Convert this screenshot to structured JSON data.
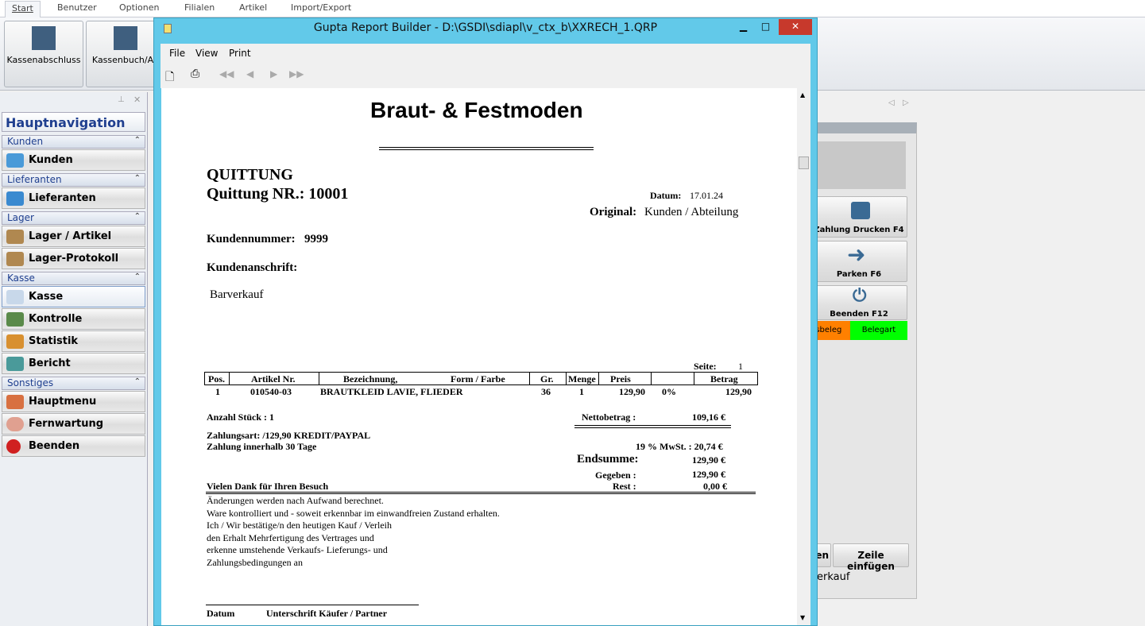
{
  "tabs": [
    "Start",
    "Benutzer",
    "Optionen",
    "Filialen",
    "Artikel",
    "Import/Export"
  ],
  "ribbon": {
    "kassenabschluss": "Kassenabschluss",
    "kassenbuch": "Kassenbuch/Au"
  },
  "sidebar": {
    "title": "Hauptnavigation",
    "sections": {
      "kunden": "Kunden",
      "lieferanten": "Lieferanten",
      "lager": "Lager",
      "kasse": "Kasse",
      "sonstiges": "Sonstiges"
    },
    "items": {
      "kunden": "Kunden",
      "lieferanten": "Lieferanten",
      "lager_artikel": "Lager / Artikel",
      "lager_protokoll": "Lager-Protokoll",
      "kasse": "Kasse",
      "kontrolle": "Kontrolle",
      "statistik": "Statistik",
      "bericht": "Bericht",
      "hauptmenu": "Hauptmenu",
      "fernwartung": "Fernwartung",
      "beenden": "Beenden"
    }
  },
  "right": {
    "zahlung_drucken": "Zahlung Drucken F4",
    "parken": "Parken F6",
    "beenden": "Beenden  F12",
    "beleg": "gsbeleg",
    "belegart": "Belegart",
    "btn_partial": "en",
    "zeile_einfuegen": "Zeile einfügen",
    "verkauf": "erkauf",
    "colors": {
      "orange": "#ff8000",
      "green": "#00ff00"
    }
  },
  "dialog": {
    "title": "Gupta Report Builder - D:\\GSDI\\sdiapl\\v_ctx_b\\XXRECH_1.QRP",
    "menu": [
      "File",
      "View",
      "Print"
    ]
  },
  "report": {
    "company": "Braut- & Festmoden",
    "doc_type": "QUITTUNG",
    "doc_nr_label": "Quittung  NR.:",
    "doc_nr": "10001",
    "datum_label": "Datum:",
    "datum": "17.01.24",
    "original_label": "Original:",
    "original": "Kunden / Abteilung",
    "kundennummer_label": "Kundennummer:",
    "kundennummer": "9999",
    "anschrift_label": "Kundenanschrift:",
    "anschrift": "Barverkauf",
    "seite_label": "Seite:",
    "seite": "1",
    "columns": [
      "Pos.",
      "Artikel Nr.",
      "Bezeichnung,",
      "Form / Farbe",
      "Gr.",
      "Menge",
      "Preis",
      "",
      "Betrag"
    ],
    "rows": [
      {
        "pos": "1",
        "artikel": "010540-03",
        "bez": "BRAUTKLEID LAVIE, FLIEDER",
        "gr": "36",
        "menge": "1",
        "preis": "129,90",
        "rabatt": "0%",
        "betrag": "129,90"
      }
    ],
    "anzahl": "Anzahl Stück : 1",
    "netto_label": "Nettobetrag :",
    "netto": "109,16 €",
    "zahlungsart": "Zahlungsart:  /129,90 KREDIT/PAYPAL",
    "zahlung_frist": "Zahlung innerhalb 30 Tage",
    "mwst": "19 % MwSt. : 20,74 €",
    "endsumme_label": "Endsumme:",
    "endsumme": "129,90 €",
    "gegeben_label": "Gegeben :",
    "gegeben": "129,90 €",
    "rest_label": "Rest :",
    "rest": "0,00 €",
    "dank": "Vielen Dank für Ihren Besuch",
    "footer_lines": [
      "Änderungen werden nach Aufwand berechnet.",
      "Ware kontrolliert und - soweit erkennbar im einwandfreien Zustand erhalten.",
      "Ich / Wir bestätige/n den heutigen Kauf / Verleih",
      "den Erhalt Mehrfertigung des Vertrages und",
      "erkenne umstehende Verkaufs- Lieferungs- und",
      "Zahlungsbedingungen an"
    ],
    "sig_datum": "Datum",
    "sig_unterschrift": "Unterschrift  Käufer / Partner"
  }
}
